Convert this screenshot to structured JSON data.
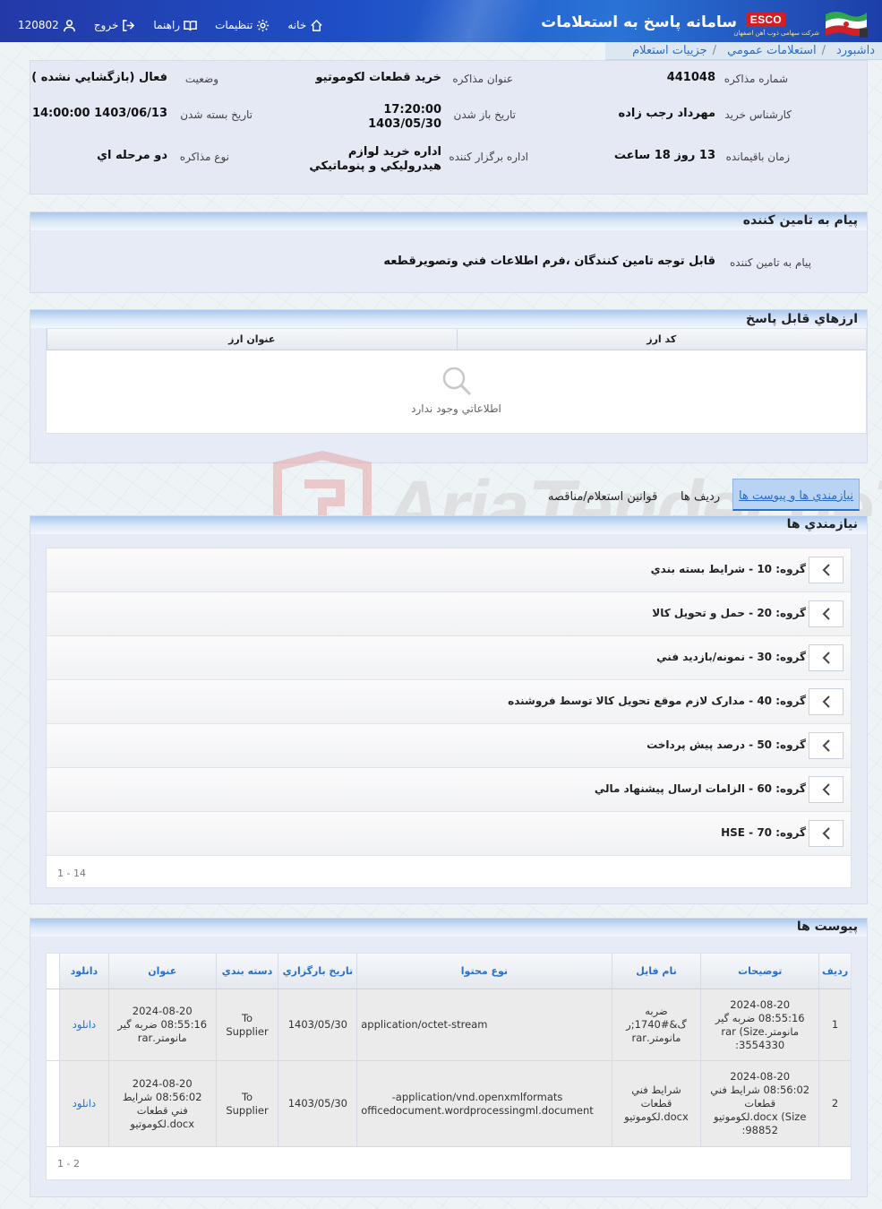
{
  "header": {
    "system_title": "سامانه پاسخ به استعلامات",
    "brand": "ESCO",
    "brand_sub": "شرکت سهامی ذوب آهن اصفهان",
    "nav": {
      "home": "خانه",
      "settings": "تنظیمات",
      "guide": "راهنما",
      "logout": "خروج",
      "user": "120802"
    }
  },
  "breadcrumb": {
    "items": [
      "داشبورد",
      "استعلامات عمومي",
      "جزييات استعلام"
    ]
  },
  "info": {
    "negotiation_no": {
      "label": "شماره مذاکره",
      "value": "441048"
    },
    "title": {
      "label": "عنوان مذاکره",
      "value": "خريد قطعات لکوموتيو"
    },
    "status": {
      "label": "وضعيت",
      "value": "فعال (بازگشايي نشده )"
    },
    "buyer": {
      "label": "کارشناس خريد",
      "value": "مهرداد رجب زاده"
    },
    "open_date": {
      "label": "تاريخ باز شدن",
      "value_time": "17:20:00",
      "value_date": "1403/05/30"
    },
    "close_date": {
      "label": "تاريخ بسته شدن",
      "value": "1403/06/13 14:00:00"
    },
    "remaining": {
      "label": "زمان باقيمانده",
      "value": "13 روز 18 ساعت"
    },
    "org": {
      "label": "اداره برگزار کننده",
      "value_line1": "اداره خريد لوازم",
      "value_line2": "هيدروليکي و پنوماتيکي"
    },
    "type": {
      "label": "نوع مذاکره",
      "value": "دو مرحله اي"
    }
  },
  "message": {
    "title": "پيام به تامين کننده",
    "label": "پيام به تامين کننده",
    "value": "قابل توجه تامين كنندگان ،فرم اطلاعات فني وتصويرقطعه"
  },
  "currencies": {
    "title": "ارزهاي قابل پاسخ",
    "col_code": "کد ارز",
    "col_title": "عنوان ارز",
    "empty": "اطلاعاتي وجود ندارد"
  },
  "tabs": {
    "needs": "نيازمندي ها و پيوست ها",
    "rows": "رديف ها",
    "rules": "قوانين استعلام/مناقصه"
  },
  "needs": {
    "title": "نيازمندي ها",
    "groups": [
      "گروه: 10 - شرايط بسته بندي",
      "گروه: 20 - حمل و تحويل کالا",
      "گروه: 30 - نمونه/بازديد فني",
      "گروه: 40 - مدارک لازم موقع تحويل کالا توسط فروشنده",
      "گروه: 50 - درصد پيش پرداخت",
      "گروه: 60 - الزامات ارسال پيشنهاد مالي",
      "گروه: 70 - HSE"
    ],
    "pager": "1 - 14"
  },
  "attachments": {
    "title": "پيوست ها",
    "columns": {
      "row": "رديف",
      "desc": "توضيحات",
      "filename": "نام فايل",
      "content_type": "نوع محتوا",
      "upload_date": "تاريخ بارگزاري",
      "category": "دسته بندي",
      "title": "عنوان",
      "download": "دانلود"
    },
    "rows": [
      {
        "row": "1",
        "desc": [
          "2024-08-20",
          "08:55:16 ضربه گير",
          "مانومتر.rar (Size",
          "3554330:"
        ],
        "filename": [
          "ضربه",
          "گ&#1740;ر",
          "مانومتر.rar"
        ],
        "content_type": [
          "application/octet-stream"
        ],
        "upload_date": "1403/05/30",
        "category": [
          "To",
          "Supplier"
        ],
        "title": [
          "2024-08-20",
          "08:55:16 ضربه گير",
          "مانومتر.rar"
        ],
        "download": "دانلود"
      },
      {
        "row": "2",
        "desc": [
          "2024-08-20",
          "08:56:02 شرايط فني",
          "قطعات",
          "docx (Size.لکوموتيو",
          "98852:"
        ],
        "filename": [
          "شرايط فني",
          "قطعات",
          "docx.لکوموتيو"
        ],
        "content_type": [
          "application/vnd.openxmlformats-",
          "officedocument.wordprocessingml.document"
        ],
        "upload_date": "1403/05/30",
        "category": [
          "To",
          "Supplier"
        ],
        "title": [
          "2024-08-20",
          "08:56:02 شرايط",
          "فني قطعات",
          "docx.لکوموتيو"
        ],
        "download": "دانلود"
      }
    ],
    "pager": "1 - 2"
  },
  "watermark": "AriaTender.neT"
}
